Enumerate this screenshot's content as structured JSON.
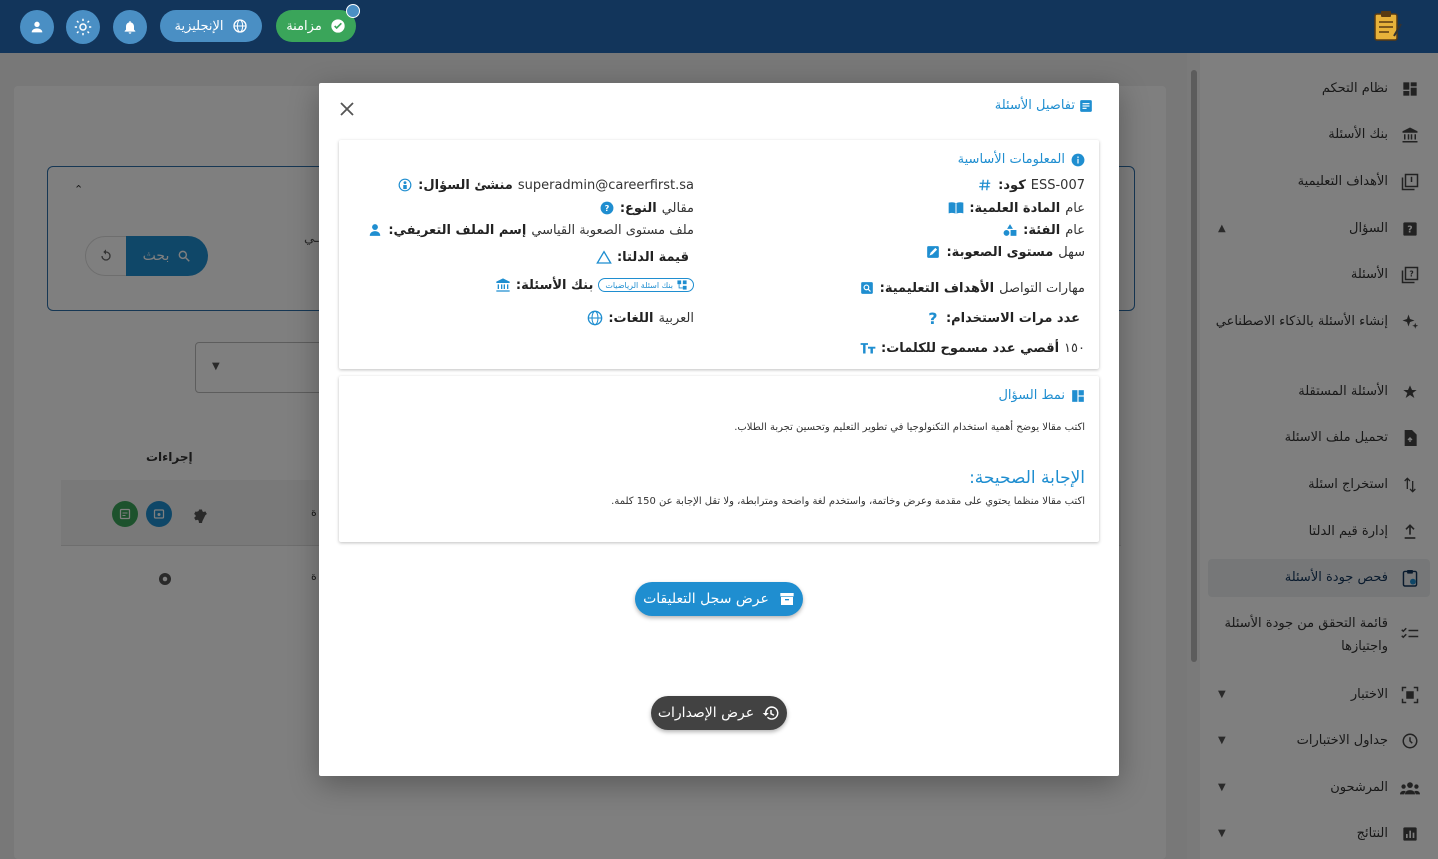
{
  "topbar": {
    "language_label": "الإنجليزية",
    "sync_label": "مزامنة"
  },
  "background": {
    "search_button": "بحث",
    "actions_header": "إجراءات",
    "partial_text_1": "ـي",
    "partial_cell": "ة"
  },
  "sidebar": {
    "items": [
      {
        "label": "نظام التحكم",
        "icon": "dashboard-icon"
      },
      {
        "label": "بنك الأسئلة",
        "icon": "bank-icon"
      },
      {
        "label": "الأهداف التعليمية",
        "icon": "book-icon"
      },
      {
        "label": "السؤال",
        "icon": "help-box-icon"
      },
      {
        "label": "الأسئلة",
        "icon": "question-list-icon"
      },
      {
        "label": "إنشاء الأسئلة بالذكاء الاصطناعي",
        "icon": "sparkle-icon"
      },
      {
        "label": "الأسئلة المستقلة",
        "icon": "star-icon"
      },
      {
        "label": "تحميل ملف الاسئلة",
        "icon": "file-upload-icon"
      },
      {
        "label": "استخراج اسئلة",
        "icon": "swap-vertical-icon"
      },
      {
        "label": "إدارة قيم الدلتا",
        "icon": "upload-icon"
      },
      {
        "label": "فحص جودة الأسئلة",
        "icon": "clipboard-check-icon"
      },
      {
        "label": "قائمة التحقق من جودة الأسئلة واجتيازها",
        "icon": "checklist-icon"
      },
      {
        "label": "الاختبار",
        "icon": "exam-icon"
      },
      {
        "label": "جداول الاختبارات",
        "icon": "clock-icon"
      },
      {
        "label": "المرشحون",
        "icon": "people-icon"
      },
      {
        "label": "النتائج",
        "icon": "chart-icon"
      }
    ]
  },
  "modal": {
    "title": "تفاصيل الأسئلة",
    "basic_info": {
      "heading": "المعلومات الأساسية",
      "code_label": "كود:",
      "code_value": "ESS-007",
      "subject_label": "المادة العلمية:",
      "subject_value": "عام",
      "category_label": "الفئة:",
      "category_value": "عام",
      "difficulty_label": "مستوى الصعوبة:",
      "difficulty_value": "سهل",
      "objectives_label": "الأهداف التعليمية:",
      "objectives_value": "مهارات التواصل",
      "usage_label": "عدد مرات الاستخدام:",
      "usage_value": "",
      "max_words_label": "أقصي عدد مسموح للكلمات:",
      "max_words_value": "١٥٠",
      "creator_label": "منشئ السؤال:",
      "creator_value": "superadmin@careerfirst.sa",
      "type_label": "النوع:",
      "type_value": "مقالي",
      "profile_label": "إسم الملف التعريفي:",
      "profile_value": "ملف مستوى الصعوبة القياسي",
      "delta_label": "قيمة الدلتا:",
      "delta_value": "",
      "bank_label": "بنك الأسئلة:",
      "bank_chip": "بنك اسئلة الرياضيات",
      "languages_label": "اللغات:",
      "languages_value": "العربية"
    },
    "question_pattern": {
      "heading": "نمط السؤال",
      "question_text": "اكتب مقالا يوضح أهمية استخدام التكنولوجيا في تطوير التعليم وتحسين تجربة الطلاب.",
      "answer_heading": "الإجابة الصحيحة:",
      "answer_text": "اكتب مقالا منظما يحتوي على مقدمة وعرض وخاتمة، واستخدم لغة واضحة ومترابطة، ولا تقل الإجابة عن 150 كلمة."
    },
    "comments_button": "عرض سجل التعليقات",
    "versions_button": "عرض الإصدارات"
  }
}
